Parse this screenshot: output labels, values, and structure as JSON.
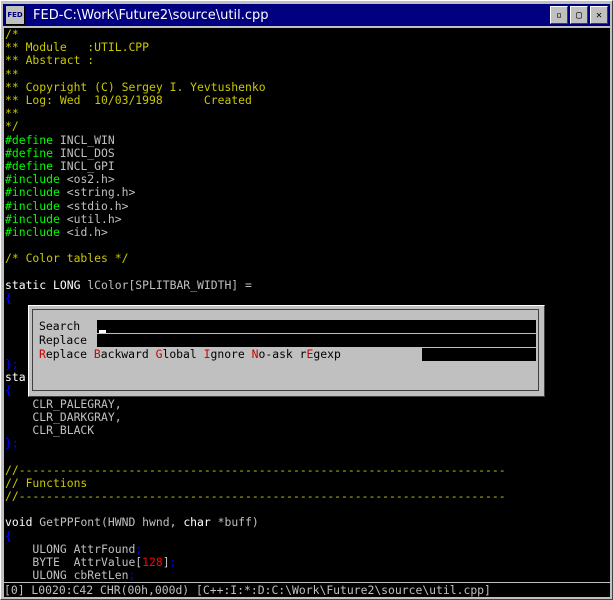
{
  "window": {
    "title": "FED-C:\\Work\\Future2\\source\\util.cpp",
    "sysmenu_label": "FED",
    "controls": [
      "minimize",
      "restore",
      "close"
    ]
  },
  "editor": {
    "lines": [
      [
        {
          "t": "/*",
          "c": "comment"
        }
      ],
      [
        {
          "t": "** Module   :UTIL.CPP",
          "c": "comment"
        }
      ],
      [
        {
          "t": "** Abstract :",
          "c": "comment"
        }
      ],
      [
        {
          "t": "**",
          "c": "comment"
        }
      ],
      [
        {
          "t": "** Copyright (C) Sergey I. Yevtushenko",
          "c": "comment"
        }
      ],
      [
        {
          "t": "** Log: Wed  10/03/1998      Created",
          "c": "comment"
        }
      ],
      [
        {
          "t": "**",
          "c": "comment"
        }
      ],
      [
        {
          "t": "*/",
          "c": "comment"
        }
      ],
      [
        {
          "t": "#define",
          "c": "pp"
        },
        {
          "t": " INCL_WIN",
          "c": "text"
        }
      ],
      [
        {
          "t": "#define",
          "c": "pp"
        },
        {
          "t": " INCL_DOS",
          "c": "text"
        }
      ],
      [
        {
          "t": "#define",
          "c": "pp"
        },
        {
          "t": " INCL_GPI",
          "c": "text"
        }
      ],
      [
        {
          "t": "#include",
          "c": "pp"
        },
        {
          "t": " <os2.h>",
          "c": "text"
        }
      ],
      [
        {
          "t": "#include",
          "c": "pp"
        },
        {
          "t": " <string.h>",
          "c": "text"
        }
      ],
      [
        {
          "t": "#include",
          "c": "pp"
        },
        {
          "t": " <stdio.h>",
          "c": "text"
        }
      ],
      [
        {
          "t": "#include",
          "c": "pp"
        },
        {
          "t": " <util.h>",
          "c": "text"
        }
      ],
      [
        {
          "t": "#include",
          "c": "pp"
        },
        {
          "t": " <id.h>",
          "c": "text"
        }
      ],
      [],
      [
        {
          "t": "/* Color tables */",
          "c": "comment"
        }
      ],
      [],
      [
        {
          "t": "static LONG",
          "c": "kw"
        },
        {
          "t": " lColor[SPLITBAR_WIDTH] =",
          "c": "text"
        }
      ],
      [
        {
          "t": "{",
          "c": "brace"
        }
      ],
      [],
      [],
      [],
      [],
      [],
      [
        {
          "t": "sta",
          "c": "kw"
        }
      ],
      [
        {
          "t": "{",
          "c": "brace"
        }
      ],
      [
        {
          "t": "    CLR_PALEGRAY,",
          "c": "text"
        }
      ],
      [
        {
          "t": "    CLR_DARKGRAY,",
          "c": "text"
        }
      ],
      [
        {
          "t": "    CLR_BLACK",
          "c": "text"
        }
      ],
      [
        {
          "t": "};",
          "c": "brace"
        }
      ],
      [],
      [
        {
          "t": "//-----------------------------------------------------------------------",
          "c": "comment"
        }
      ],
      [
        {
          "t": "// Functions",
          "c": "comment"
        }
      ],
      [
        {
          "t": "//-----------------------------------------------------------------------",
          "c": "comment"
        }
      ],
      [],
      [
        {
          "t": "void",
          "c": "kw"
        },
        {
          "t": " GetPPFont(HWND hwnd, ",
          "c": "text"
        },
        {
          "t": "char",
          "c": "kw"
        },
        {
          "t": " *buff)",
          "c": "text"
        }
      ],
      [
        {
          "t": "{",
          "c": "brace"
        }
      ],
      [
        {
          "t": "    ULONG AttrFound",
          "c": "text"
        },
        {
          "t": ";",
          "c": "brace"
        }
      ],
      [
        {
          "t": "    BYTE  AttrValue[",
          "c": "text"
        },
        {
          "t": "128",
          "c": "num"
        },
        {
          "t": "]",
          "c": "text"
        },
        {
          "t": ";",
          "c": "brace"
        }
      ],
      [
        {
          "t": "    ULONG cbRetLen",
          "c": "text"
        },
        {
          "t": ";",
          "c": "brace"
        }
      ]
    ],
    "partial_lines": [
      {
        "row": 25,
        "t": "};",
        "c": "brace"
      }
    ]
  },
  "search_dialog": {
    "search_label": "Search",
    "replace_label": "Replace",
    "search_value": "",
    "replace_value": "",
    "options": [
      {
        "hotkey": "R",
        "rest": "eplace"
      },
      {
        "hotkey": "B",
        "rest": "ackward"
      },
      {
        "hotkey": "G",
        "rest": "lobal"
      },
      {
        "hotkey": "I",
        "rest": "gnore"
      },
      {
        "hotkey": "N",
        "rest": "o-ask"
      },
      {
        "prefix": "r",
        "hotkey": "E",
        "rest": "gexp"
      }
    ]
  },
  "status_bar": {
    "text": "[0] L0020:C42 CHR(00h,000d) [C++:I:*:D:C:\\Work\\Future2\\source\\util.cpp]"
  },
  "colors": {
    "editor_bg": "#000000",
    "comment": "#c8c800",
    "preprocessor": "#00ff00",
    "brace": "#0000ff",
    "keyword": "#ffffff",
    "number": "#ff0000",
    "titlebar": "#000080"
  }
}
